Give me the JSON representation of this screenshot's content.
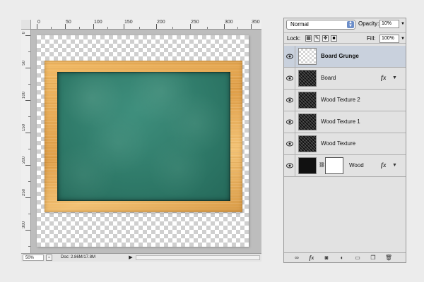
{
  "ruler": {
    "top_labels": [
      "0",
      "50",
      "100",
      "150",
      "200",
      "250",
      "300",
      "350"
    ],
    "left_labels": [
      "0",
      "50",
      "100",
      "150",
      "200",
      "250",
      "300"
    ]
  },
  "status": {
    "zoom": "50%",
    "doc_info": "Doc: 2.86M/17.8M"
  },
  "layers_panel": {
    "blend_mode": "Normal",
    "opacity_label": "Opacity:",
    "opacity_value": "10%",
    "lock_label": "Lock:",
    "fill_label": "Fill:",
    "fill_value": "100%",
    "layers": [
      {
        "name": "Board Grunge",
        "selected": true,
        "fx": false,
        "visible": true,
        "thumb": "light",
        "bold": true
      },
      {
        "name": "Board",
        "selected": false,
        "fx": true,
        "visible": true,
        "thumb": "dark",
        "bold": false
      },
      {
        "name": "Wood Texture 2",
        "selected": false,
        "fx": false,
        "visible": true,
        "thumb": "dark",
        "bold": false
      },
      {
        "name": "Wood Texture 1",
        "selected": false,
        "fx": false,
        "visible": true,
        "thumb": "dark",
        "bold": false
      },
      {
        "name": "Wood Texture",
        "selected": false,
        "fx": false,
        "visible": true,
        "thumb": "dark",
        "bold": false
      },
      {
        "name": "Wood",
        "selected": false,
        "fx": true,
        "visible": true,
        "thumb": "dark",
        "bold": false,
        "mask": true
      }
    ],
    "fx_label": "fx"
  },
  "icons": {
    "eye": "eye-icon",
    "link": "link-layers-icon",
    "fx": "add-layer-style-icon",
    "mask": "add-mask-icon",
    "adjust": "new-adjustment-layer-icon",
    "group": "new-group-icon",
    "new": "new-layer-icon",
    "trash": "delete-layer-icon"
  },
  "colors": {
    "selection": "#c9d1dd",
    "chalkboard": "#2f7a69",
    "wood": "#e0a04a",
    "select_arrow": "#6c8ec9"
  }
}
